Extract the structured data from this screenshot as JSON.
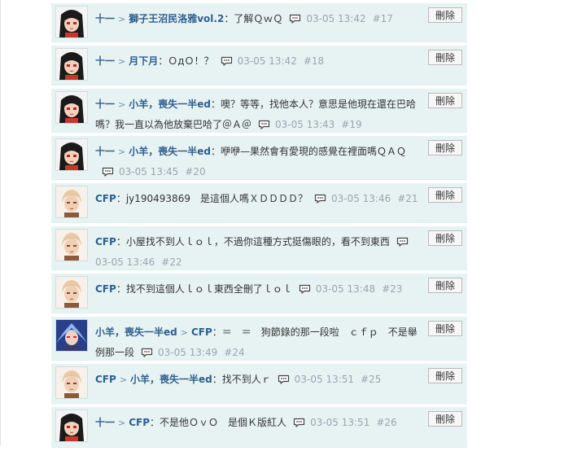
{
  "delete_label": "刪除",
  "comments": [
    {
      "avatar": "dark-hair-girl-avatar",
      "chain": [
        "十一",
        "獅子王沼民洛雅vol.2"
      ],
      "text": "：了解ＱｗＱ",
      "time": "03-05 13:42",
      "floor": "#17"
    },
    {
      "avatar": "dark-hair-girl-avatar",
      "chain": [
        "十一",
        "月下月"
      ],
      "text": "：ＯдＯ！？",
      "time": "03-05 13:42",
      "floor": "#18"
    },
    {
      "avatar": "dark-hair-girl-avatar",
      "chain": [
        "十一",
        "小羊，喪失一半ed"
      ],
      "text": "：噢？等等，找他本人？意思是他現在還在巴哈嗎？我一直以為他放棄巴哈了＠Ａ＠",
      "time": "03-05 13:43",
      "floor": "#19"
    },
    {
      "avatar": "dark-hair-girl-avatar",
      "chain": [
        "十一",
        "小羊，喪失一半ed"
      ],
      "text": "：咿咿—果然會有愛現的感覺在裡面嗎ＱＡＱ",
      "time": "03-05 13:45",
      "floor": "#20"
    },
    {
      "avatar": "blond-boy-avatar",
      "chain": [
        "CFP"
      ],
      "text": "：jy190493869　是這個人嗎ＸＤＤＤＤ？",
      "time": "03-05 13:46",
      "floor": "#21"
    },
    {
      "avatar": "blond-boy-avatar",
      "chain": [
        "CFP"
      ],
      "text": "：小屋找不到人ｌｏｌ，不過你這種方式挺傷眼的，看不到東西",
      "time": "03-05 13:46",
      "floor": "#22"
    },
    {
      "avatar": "blond-boy-avatar",
      "chain": [
        "CFP"
      ],
      "text": "：找不到這個人ｌｏｌ東西全刪了ｌｏｌ",
      "time": "03-05 13:48",
      "floor": "#23"
    },
    {
      "avatar": "blue-hair-elf-avatar",
      "chain": [
        "小羊，喪失一半ed",
        "CFP"
      ],
      "text": "：＝　＝　狗節錄的那一段啦　ｃｆｐ　不是舉例那一段",
      "time": "03-05 13:49",
      "floor": "#24"
    },
    {
      "avatar": "blond-boy-avatar",
      "chain": [
        "CFP",
        "小羊，喪失一半ed"
      ],
      "text": "：找不到人ｒ",
      "time": "03-05 13:51",
      "floor": "#25"
    },
    {
      "avatar": "dark-hair-girl-avatar",
      "chain": [
        "十一",
        "CFP"
      ],
      "text": "：不是他ＯｖＯ　是個Ｋ版紅人",
      "time": "03-05 13:51",
      "floor": "#26"
    }
  ]
}
